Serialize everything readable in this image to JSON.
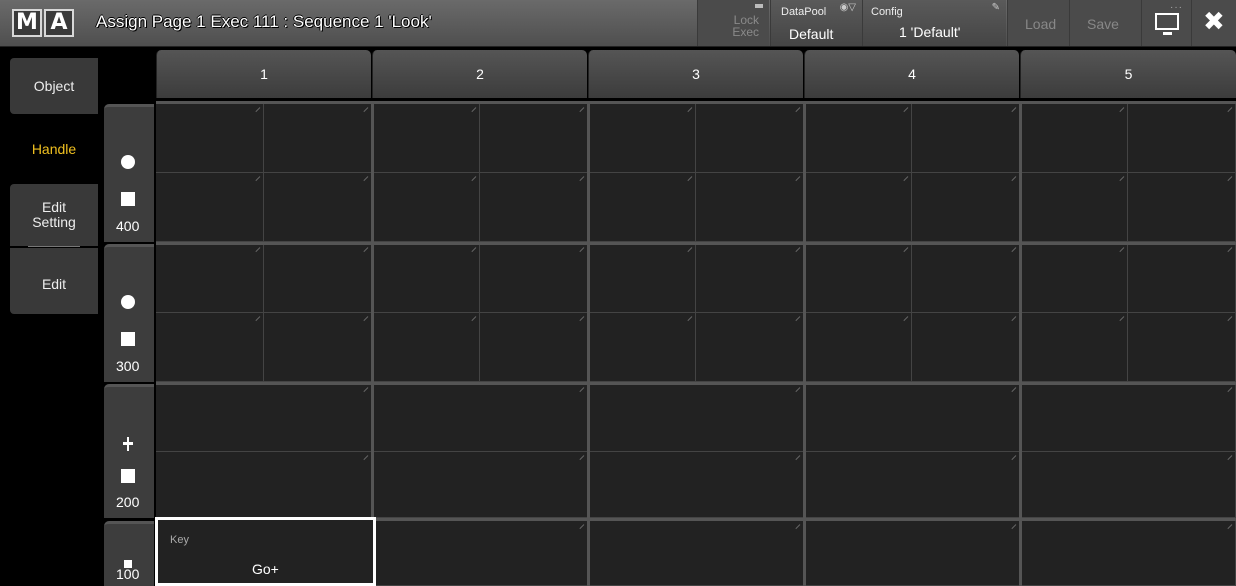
{
  "titlebar": {
    "logo_letters": [
      "M",
      "A"
    ],
    "title": "Assign Page 1 Exec 111 : Sequence 1 'Look'",
    "lock_exec": {
      "line1": "Lock",
      "line2": "Exec"
    },
    "datapool": {
      "label": "DataPool",
      "value": "Default",
      "icon": "eye-icon"
    },
    "config": {
      "label": "Config",
      "value": "1 'Default'",
      "icon": "pencil-icon"
    },
    "load": "Load",
    "save": "Save",
    "screen_icon": "monitor-icon",
    "close_icon": "close-icon"
  },
  "tabs": {
    "object": "Object",
    "handle": "Handle",
    "edit_setting_1": "Edit",
    "edit_setting_2": "Setting",
    "edit": "Edit",
    "active_color": "#f0c020"
  },
  "columns": [
    "1",
    "2",
    "3",
    "4",
    "5"
  ],
  "rows": [
    {
      "number": "400",
      "icons": [
        "circle-icon",
        "square-icon"
      ]
    },
    {
      "number": "300",
      "icons": [
        "circle-icon",
        "square-icon"
      ]
    },
    {
      "number": "200",
      "icons": [
        "fader-icon",
        "square-icon"
      ]
    },
    {
      "number": "100",
      "icons": [
        "small-square-icon"
      ]
    }
  ],
  "selected_cell": {
    "label": "Key",
    "value": "Go+"
  }
}
